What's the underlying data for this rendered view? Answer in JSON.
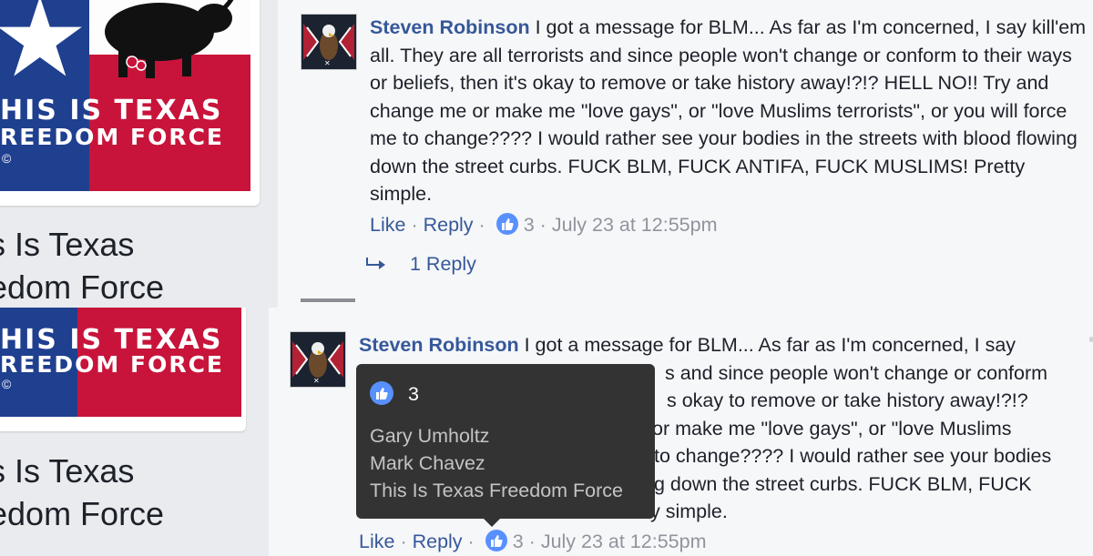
{
  "page": {
    "name_line1": "s Is Texas",
    "name_line2": "edom Force",
    "flag_line1": "HIS IS TEXAS",
    "flag_line2": "REEDOM FORCE",
    "flag_copyright": "©"
  },
  "comment_top": {
    "author": "Steven Robinson",
    "text": "I got a message for BLM... As far as I'm concerned, I say kill'em all. They are all terrorists and since people won't change or conform to their ways or beliefs, then it's okay to remove or take history away!?!? HELL NO!! Try and change me or make me \"love gays\", or \"love Muslims terrorists\", or you will force me to change???? I would rather see your bodies in the streets with blood flowing down the street curbs. FUCK BLM, FUCK ANTIFA, FUCK MUSLIMS! Pretty simple.",
    "like_label": "Like",
    "reply_label": "Reply",
    "separator": "·",
    "like_count": "3",
    "timestamp": "July 23 at 12:55pm",
    "replies_label": "1 Reply"
  },
  "comment_bottom": {
    "author": "Steven Robinson",
    "line1": "I got a message for BLM... As far as I'm concerned, I say",
    "line2": "s and since people won't change or conform",
    "line3": "s okay to remove or take history away!?!?",
    "line4": "or make me \"love gays\", or \"love Muslims",
    "line5": "to change???? I would rather see your bodies",
    "line6": "g down the street curbs. FUCK BLM, FUCK",
    "line7": "y simple.",
    "like_label": "Like",
    "reply_label": "Reply",
    "separator": "·",
    "like_count": "3",
    "timestamp": "July 23 at 12:55pm"
  },
  "tooltip": {
    "count": "3",
    "names": [
      "Gary Umholtz",
      "Mark Chavez",
      "This Is Texas Freedom Force"
    ]
  },
  "colors": {
    "link": "#365899",
    "like_blue": "#5890ff",
    "flag_blue": "#1f3f8f",
    "flag_red": "#c8143a"
  }
}
